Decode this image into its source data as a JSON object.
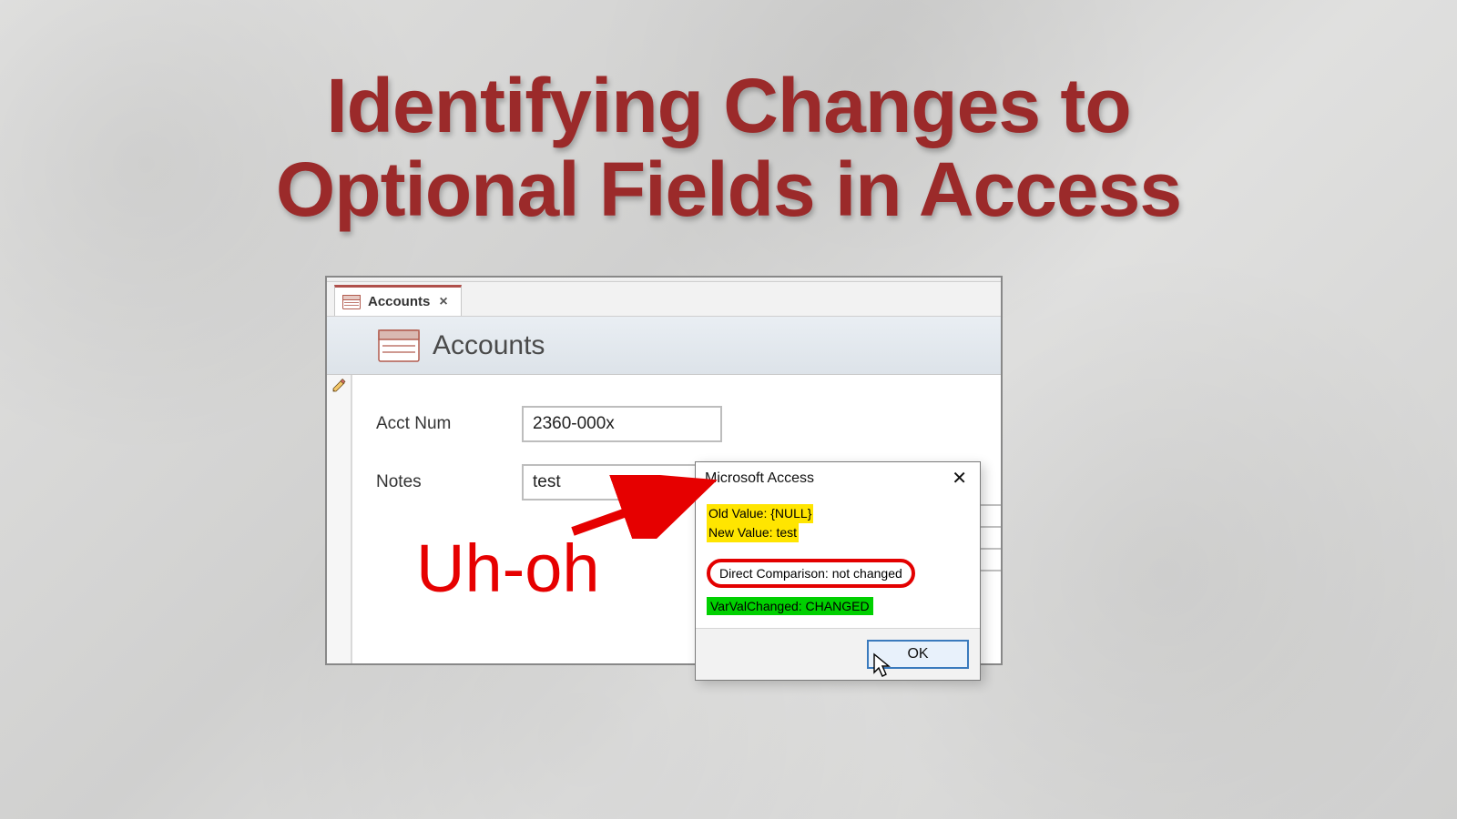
{
  "headline_line1": "Identifying Changes to",
  "headline_line2": "Optional Fields in Access",
  "tab": {
    "label": "Accounts"
  },
  "form": {
    "title": "Accounts",
    "fields": {
      "acct_num": {
        "label": "Acct Num",
        "value": "2360-000x"
      },
      "notes": {
        "label": "Notes",
        "value": "test"
      }
    }
  },
  "uhoh": "Uh-oh",
  "msgbox": {
    "title": "Microsoft Access",
    "old_value": "Old Value: {NULL}",
    "new_value": "New Value: test",
    "direct": "Direct Comparison: not changed",
    "varval": "VarValChanged: CHANGED",
    "ok": "OK"
  }
}
